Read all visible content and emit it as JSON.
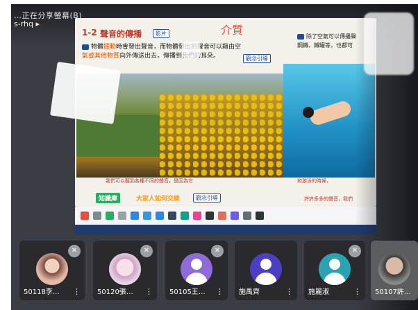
{
  "meeting": {
    "share_notice": "…正在分享螢幕(B)",
    "url_fragment": "s-rhq ▸"
  },
  "slide": {
    "section_number": "1-2",
    "section_title": "聲音的傳播",
    "tag_button": "影片",
    "handwritten_note": "介質",
    "body_line1_a": "物體",
    "body_line1_hl": "振動",
    "body_line1_b": "時會發出聲音，而物體發出的聲音可以藉由空",
    "body_line2_hl": "氣或其他物質",
    "body_line2_b": "向外傳送出去，傳播到我們的耳朵。",
    "ref_button": "觀念引導",
    "right_text_1": "除了空氣可以傳播聲",
    "right_text_2": "鋼鐵、鐵罐等，也都可",
    "caption_left": "我們可以聽到各種不同的聲音，是因為它",
    "caption_right": "和游泳的時候，",
    "knowledge_label": "知識庫",
    "knowledge_link": "大家人如何交談",
    "ref_button_2": "觀念引導",
    "caption_far": "許許多多的聲音，我們"
  },
  "toolbar": {
    "items": [
      "主頁",
      "工具",
      "畫筆",
      "工具",
      "上一頁",
      "插入頁面",
      "下一頁",
      "電子書",
      "全部",
      "學生",
      "畫筆",
      "工具",
      "全部"
    ]
  },
  "participants": [
    {
      "name": "50118李…",
      "avatar": "photo-avatar",
      "muted": true
    },
    {
      "name": "50120張…",
      "avatar": "anime-avatar",
      "muted": true
    },
    {
      "name": "50105王…",
      "avatar": "default-avatar",
      "color": "#8e6bd8",
      "muted": true
    },
    {
      "name": "施禹齊",
      "avatar": "default-avatar",
      "color": "#4b3fc4",
      "muted": false
    },
    {
      "name": "施麗淑",
      "avatar": "default-avatar",
      "color": "#2aa3b3",
      "muted": true
    },
    {
      "name": "50107許…",
      "avatar": "photo-avatar",
      "muted": false
    }
  ],
  "icons": {
    "mute": "mic-off-icon",
    "more": "more-vertical-icon"
  }
}
